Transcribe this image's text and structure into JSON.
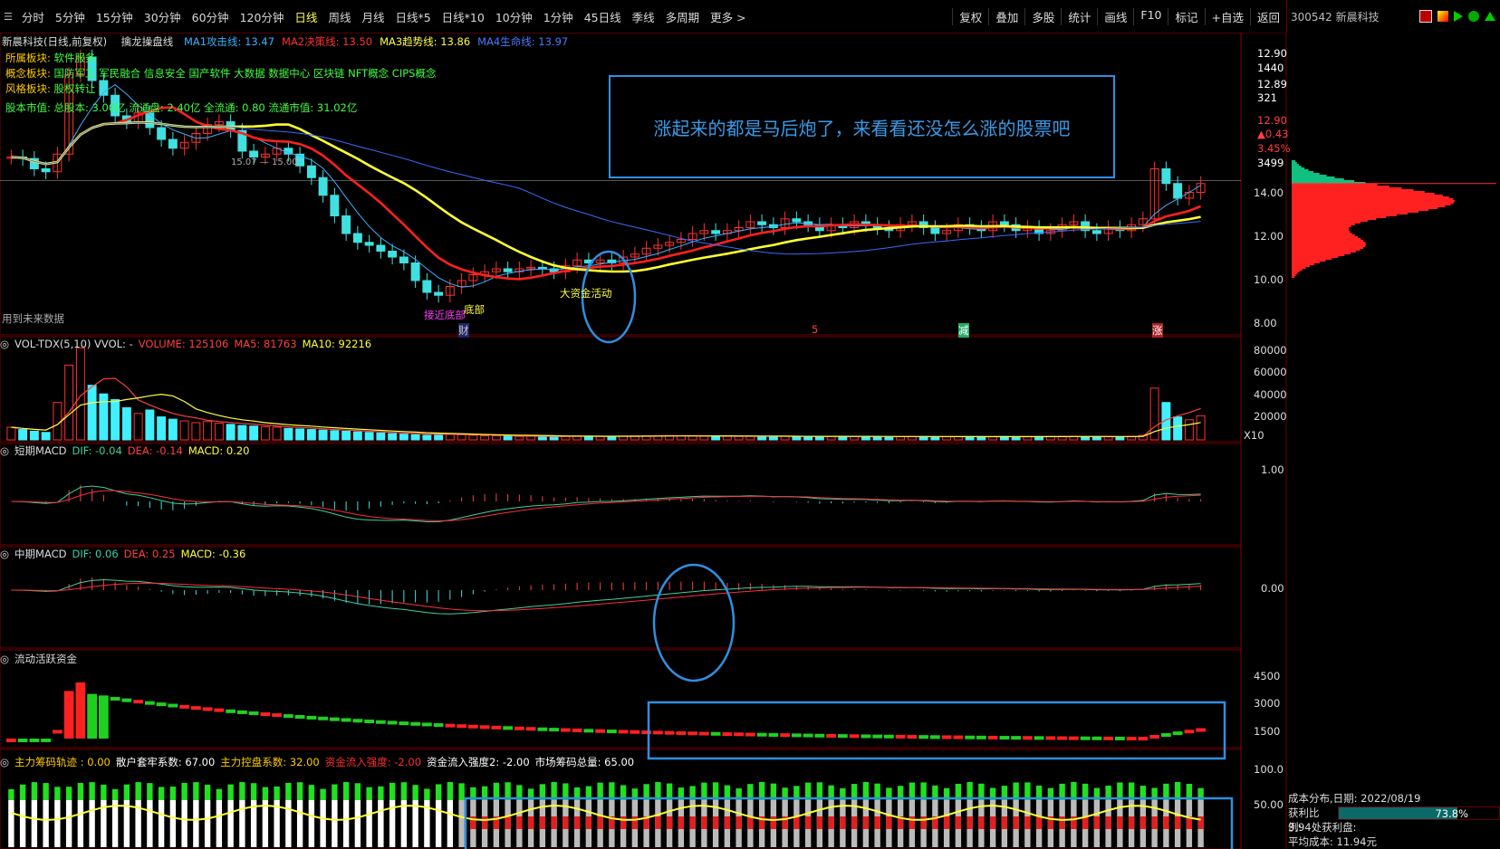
{
  "toolbar": {
    "periods": [
      "分时",
      "5分钟",
      "15分钟",
      "30分钟",
      "60分钟",
      "120分钟",
      "日线",
      "周线",
      "月线",
      "日线*5",
      "日线*10",
      "10分钟",
      "1分钟",
      "45日线",
      "季线",
      "多周期",
      "更多 >"
    ],
    "active_period": "日线",
    "right_buttons": [
      "复权",
      "叠加",
      "多股",
      "统计",
      "画线",
      "F10",
      "标记",
      "+自选",
      "返回"
    ]
  },
  "stock": {
    "code_name": "300542 新晨科技",
    "title": "新晨科技(日线,前复权)",
    "indicator_name": "擒龙操盘线"
  },
  "ma_legend": [
    {
      "label": "MA1攻击线: 13.47",
      "color": "#3ab0ff"
    },
    {
      "label": "MA2决策线: 13.50",
      "color": "#ff3030"
    },
    {
      "label": "MA3趋势线: 13.86",
      "color": "#ffff40"
    },
    {
      "label": "MA4生命线: 13.97",
      "color": "#4a7aff"
    }
  ],
  "info": {
    "sector_label": "所属板块:",
    "sector_value": "软件服务",
    "concept_label": "概念板块:",
    "concept_value": "国防军工 军民融合 信息安全 国产软件 大数据 数据中心 区块链 NFT概念 CIPS概念",
    "style_label": "风格板块:",
    "style_value": "股权转让",
    "equity": "股本市值: 总股本: 3.00亿 流通盘: 2.40亿 全流通: 0.80 流通市值: 31.02亿",
    "future_data": "用到未来数据"
  },
  "price_axis": {
    "ticks": [
      "14.00",
      "12.00",
      "10.00",
      "8.00"
    ],
    "top_values": [
      {
        "text": "12.90",
        "color": "#ffffff"
      },
      {
        "text": "1440",
        "color": "#ffffff"
      },
      {
        "text": "12.89",
        "color": "#ffffff"
      },
      {
        "text": "321",
        "color": "#ffffff"
      },
      {
        "text": "12.90",
        "color": "#ff4040"
      },
      {
        "text": "▲0.43",
        "color": "#ff4040"
      },
      {
        "text": "3.45%",
        "color": "#ff4040"
      },
      {
        "text": "3499",
        "color": "#ffffff"
      }
    ]
  },
  "annotations": {
    "note": "涨起来的都是马后炮了，来看看还没怎么涨的股票吧",
    "big_money": "大资金活动",
    "bottom_catch": "接近底部",
    "bottom_label": "底部",
    "marker_cai": "财",
    "marker_wu": "5",
    "marker_jian": "减",
    "marker_zhang": "涨",
    "level_line": "15.07 — 15.00"
  },
  "vol_pane": {
    "title": "VOL-TDX(5,10) VVOL: -",
    "volume": "VOLUME: 125106",
    "ma5": "MA5: 81763",
    "ma10": "MA10: 92216",
    "ticks": [
      "80000",
      "60000",
      "40000",
      "20000"
    ],
    "unit": "X10"
  },
  "macd_short": {
    "title": "短期MACD",
    "dif": "DIF: -0.04",
    "dea": "DEA: -0.14",
    "macd": "MACD: 0.20",
    "tick": "1.00"
  },
  "macd_mid": {
    "title": "中期MACD",
    "dif": "DIF: 0.06",
    "dea": "DEA: 0.25",
    "macd": "MACD: -0.36",
    "tick": "0.00"
  },
  "liquidity": {
    "title": "流动活跃资金",
    "ticks": [
      "4500",
      "3000",
      "1500"
    ]
  },
  "chip_pane": {
    "items": [
      {
        "text": "主力筹码轨迹 : 0.00",
        "color": "#ffcc00"
      },
      {
        "text": "散户套牢系数: 67.00",
        "color": "#ffffff"
      },
      {
        "text": "主力控盘系数: 32.00",
        "color": "#ffcc00"
      },
      {
        "text": "资金流入强度: -2.00",
        "color": "#ff3030"
      },
      {
        "text": "资金流入强度2: -2.00",
        "color": "#ffffff"
      },
      {
        "text": "市场筹码总量: 65.00",
        "color": "#ffffff"
      }
    ],
    "ticks": [
      "100.0",
      "50.00"
    ]
  },
  "cost_panel": {
    "date": "成本分布,日期:  2022/08/19",
    "profit_label": "获利比例:",
    "profit_value": "73.8%",
    "profit_ratio": 0.738,
    "line3": "3.94处获利盘:",
    "line4": "平均成本: 11.94元"
  },
  "chart_data": {
    "type": "candlestick",
    "close": [
      13.8,
      13.75,
      13.4,
      13.3,
      13.9,
      16.6,
      17.2,
      16.4,
      15.9,
      15.2,
      15.0,
      15.3,
      14.8,
      14.4,
      14.1,
      14.3,
      14.6,
      14.9,
      15.0,
      14.7,
      14.0,
      13.8,
      13.9,
      14.1,
      13.9,
      13.5,
      13.1,
      12.5,
      11.8,
      11.2,
      10.9,
      10.8,
      10.6,
      10.4,
      10.2,
      9.6,
      9.2,
      9.1,
      9.4,
      9.6,
      9.8,
      9.9,
      10.0,
      9.9,
      10.0,
      10.05,
      10.0,
      9.9,
      10.1,
      10.3,
      10.2,
      10.3,
      10.2,
      10.4,
      10.5,
      10.7,
      10.8,
      10.9,
      11.0,
      11.2,
      11.3,
      11.2,
      11.3,
      11.4,
      11.6,
      11.5,
      11.4,
      11.7,
      11.6,
      11.5,
      11.3,
      11.5,
      11.4,
      11.6,
      11.5,
      11.4,
      11.3,
      11.5,
      11.6,
      11.4,
      11.2,
      11.3,
      11.5,
      11.4,
      11.3,
      11.6,
      11.5,
      11.3,
      11.4,
      11.2,
      11.3,
      11.5,
      11.6,
      11.3,
      11.2,
      11.4,
      11.3,
      11.5,
      11.7,
      13.4,
      12.9,
      12.4,
      12.6,
      12.9
    ],
    "volume": [
      2200,
      1800,
      1500,
      1300,
      6500,
      13000,
      16000,
      9500,
      8000,
      7000,
      5600,
      4600,
      5200,
      4000,
      3600,
      3300,
      3000,
      3200,
      2900,
      2700,
      2500,
      2400,
      2300,
      2200,
      2000,
      1900,
      1800,
      1700,
      1600,
      1500,
      1400,
      1300,
      1200,
      1100,
      1000,
      900,
      800,
      1000,
      1100,
      900,
      800,
      700,
      700,
      650,
      600,
      650,
      600,
      580,
      600,
      700,
      650,
      600,
      620,
      650,
      700,
      720,
      740,
      760,
      700,
      680,
      650,
      640,
      620,
      600,
      610,
      650,
      640,
      620,
      600,
      580,
      600,
      620,
      640,
      600,
      580,
      560,
      540,
      560,
      580,
      600,
      560,
      540,
      560,
      580,
      560,
      550,
      560,
      540,
      560,
      580,
      600,
      620,
      640,
      600,
      580,
      560,
      540,
      600,
      800,
      9000,
      6500,
      4000,
      3500,
      4200
    ],
    "ma_attack": 13.47,
    "ma_decision": 13.5,
    "ma_trend": 13.86,
    "ma_life": 13.97,
    "ylim": [
      8,
      17
    ]
  }
}
